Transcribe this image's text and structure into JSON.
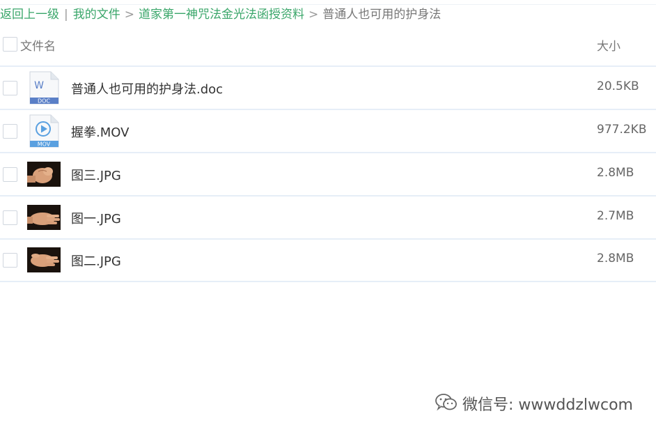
{
  "breadcrumb": {
    "back": "返回上一级",
    "separator_pipe": "|",
    "my_files": "我的文件",
    "separator": ">",
    "folder": "道家第一神咒法金光法函授资料",
    "current": "普通人也可用的护身法"
  },
  "header": {
    "name_label": "文件名",
    "size_label": "大小"
  },
  "files": [
    {
      "name": "普通人也可用的护身法.doc",
      "size": "20.5KB",
      "icon": "doc-file-icon",
      "badge": "DOC",
      "glyph": "W"
    },
    {
      "name": "握拳.MOV",
      "size": "977.2KB",
      "icon": "video-file-icon",
      "badge": "MOV"
    },
    {
      "name": "图三.JPG",
      "size": "2.8MB",
      "icon": "fist-thumbnail"
    },
    {
      "name": "图一.JPG",
      "size": "2.7MB",
      "icon": "open-hand-thumbnail"
    },
    {
      "name": "图二.JPG",
      "size": "2.8MB",
      "icon": "hand-thumbnail"
    }
  ],
  "watermark": {
    "text": "微信号: wwwddzlwcom",
    "icon": "wechat-icon"
  },
  "colors": {
    "link": "#3aa66a",
    "divider": "#e6eef7",
    "doc_badge": "#5a7fc7",
    "mov_badge": "#5aa0e0"
  }
}
